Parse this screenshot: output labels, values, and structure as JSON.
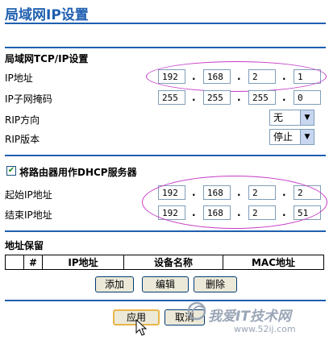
{
  "page_title": "局域网IP设置",
  "lan": {
    "section_title": "局域网TCP/IP设置",
    "ip_label": "IP地址",
    "ip": [
      "192",
      "168",
      "2",
      "1"
    ],
    "mask_label": "IP子网掩码",
    "mask": [
      "255",
      "255",
      "255",
      "0"
    ],
    "rip_dir_label": "RIP方向",
    "rip_dir_value": "无",
    "rip_ver_label": "RIP版本",
    "rip_ver_value": "停止"
  },
  "dhcp": {
    "checkbox_label": "将路由器用作DHCP服务器",
    "checked": true,
    "start_label": "起始IP地址",
    "start_ip": [
      "192",
      "168",
      "2",
      "2"
    ],
    "end_label": "结束IP地址",
    "end_ip": [
      "192",
      "168",
      "2",
      "51"
    ]
  },
  "reservation": {
    "section_title": "地址保留",
    "columns": [
      "#",
      "IP地址",
      "设备名称",
      "MAC地址"
    ],
    "add_label": "添加",
    "edit_label": "编辑",
    "delete_label": "删除"
  },
  "footer": {
    "apply_label": "应用",
    "cancel_label": "取消"
  },
  "watermark": {
    "main": "我爱IT技术网",
    "url": "www.52ij.com"
  },
  "colors": {
    "accent": "#1f5fb0",
    "annotation": "#c63ac6"
  }
}
